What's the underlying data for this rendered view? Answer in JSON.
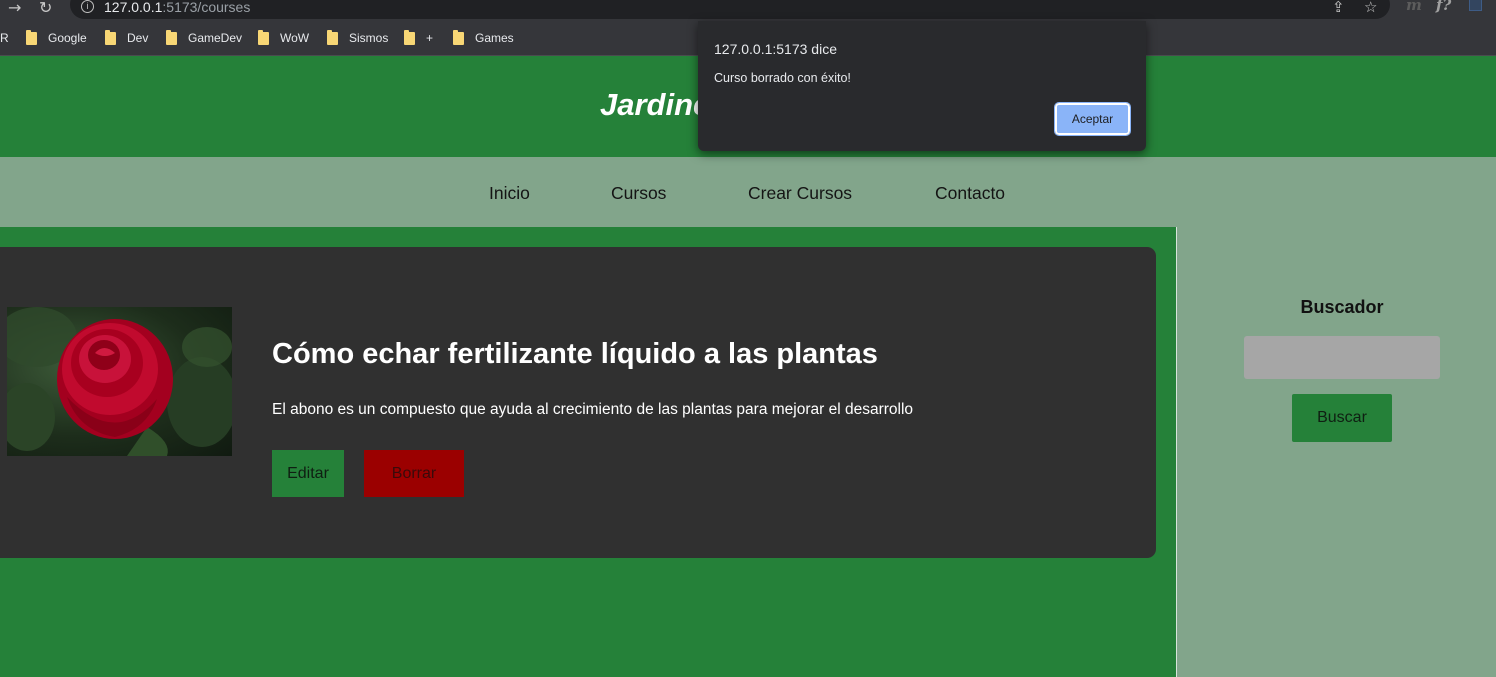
{
  "browser": {
    "url_host": "127.0.0.1",
    "url_path": ":5173/courses",
    "bookmarks_truncated": "R",
    "bookmarks": [
      "Google",
      "Dev",
      "GameDev",
      "WoW",
      "Sismos",
      "+",
      "Games"
    ]
  },
  "header": {
    "title": "Jardinería"
  },
  "nav": {
    "items": [
      "Inicio",
      "Cursos",
      "Crear Cursos",
      "Contacto"
    ]
  },
  "course": {
    "title": "Cómo echar fertilizante líquido a las plantas",
    "description": "El abono es un compuesto que ayuda al crecimiento de las plantas para mejorar el desarrollo",
    "edit_label": "Editar",
    "delete_label": "Borrar",
    "image_subject": "red-rose"
  },
  "sidebar": {
    "title": "Buscador",
    "search_value": "",
    "search_label": "Buscar"
  },
  "dialog": {
    "title": "127.0.0.1:5173 dice",
    "message": "Curso borrado con éxito!",
    "ok_label": "Aceptar"
  },
  "colors": {
    "brand_green": "#258139",
    "nav_bg": "#82a58b",
    "card_bg": "#303030",
    "delete_red": "#9b0000",
    "dialog_button": "#8ab4f8"
  }
}
